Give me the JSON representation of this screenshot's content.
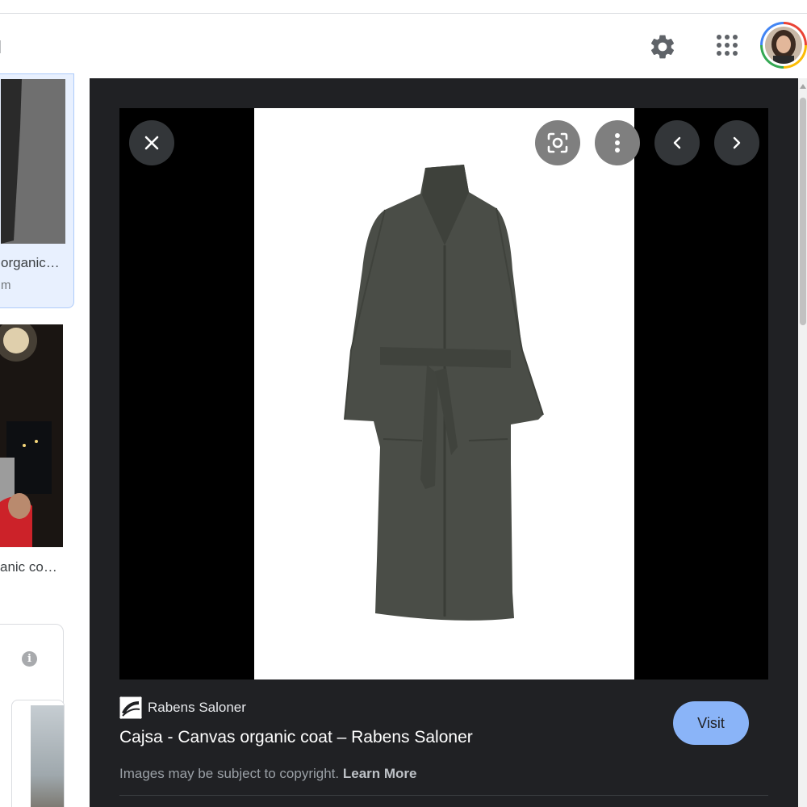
{
  "header": {
    "edge_text": "l",
    "icons": [
      "gear-icon",
      "apps-grid-icon",
      "account-avatar"
    ]
  },
  "results": {
    "items": [
      {
        "title": "organic…",
        "source": "m"
      },
      {
        "title": "anic co…"
      }
    ],
    "info_icon": "i"
  },
  "viewer": {
    "controls": [
      "close-icon",
      "lens-icon",
      "more-vert-icon",
      "chevron-left-icon",
      "chevron-right-icon"
    ],
    "source_name": "Rabens Saloner",
    "title": "Cajsa - Canvas organic coat – Rabens Saloner",
    "visit_label": "Visit",
    "copyright_text": "Images may be subject to copyright.",
    "learn_more_label": "Learn More"
  },
  "colors": {
    "panel_background": "#202124",
    "visit_button": "#8ab4f8",
    "selected_card": "#e8f0fe",
    "coat": "#4a4d47"
  }
}
